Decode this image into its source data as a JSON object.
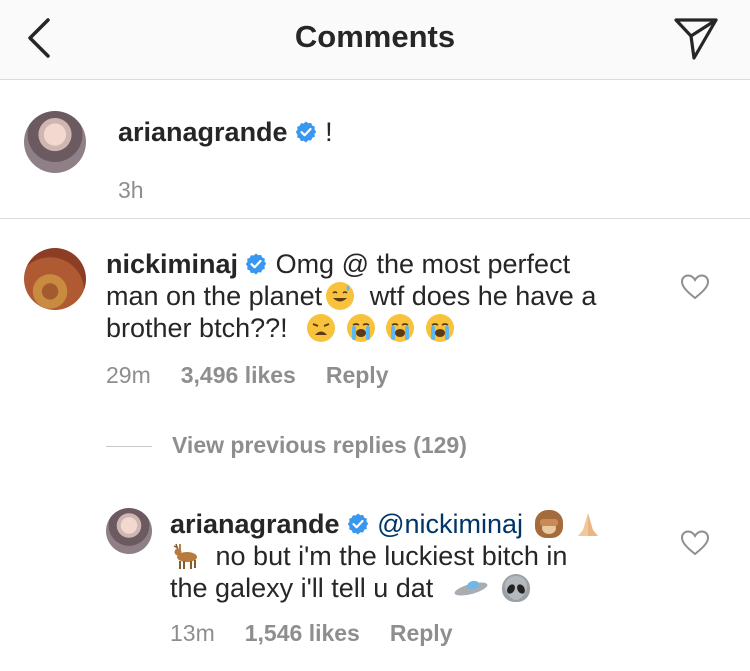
{
  "header": {
    "title": "Comments"
  },
  "caption": {
    "username": "arianagrande",
    "text": "!",
    "time": "3h"
  },
  "comment": {
    "username": "nickiminaj",
    "line1": "Omg @ the most perfect",
    "line2a": "man on the planet",
    "line2b": "wtf does he have a",
    "line3": "brother btch??!",
    "time": "29m",
    "likes": "3,496 likes",
    "reply": "Reply"
  },
  "view_previous": {
    "label": "View previous replies (129)"
  },
  "reply": {
    "username": "arianagrande",
    "mention": "@nickiminaj",
    "line2": "no but i'm the luckiest bitch in",
    "line3": "the galexy i'll tell u dat",
    "time": "13m",
    "likes": "1,546 likes",
    "reply": "Reply"
  },
  "colors": {
    "text": "#262626",
    "secondary": "#8e8e8e",
    "mention": "#003569",
    "verified": "#3897f0",
    "divider": "#dbdbdb",
    "header_bg": "#fafafa"
  },
  "icons": [
    "chevron-left-icon",
    "send-icon",
    "verified-badge-icon",
    "heart-outline-icon"
  ]
}
